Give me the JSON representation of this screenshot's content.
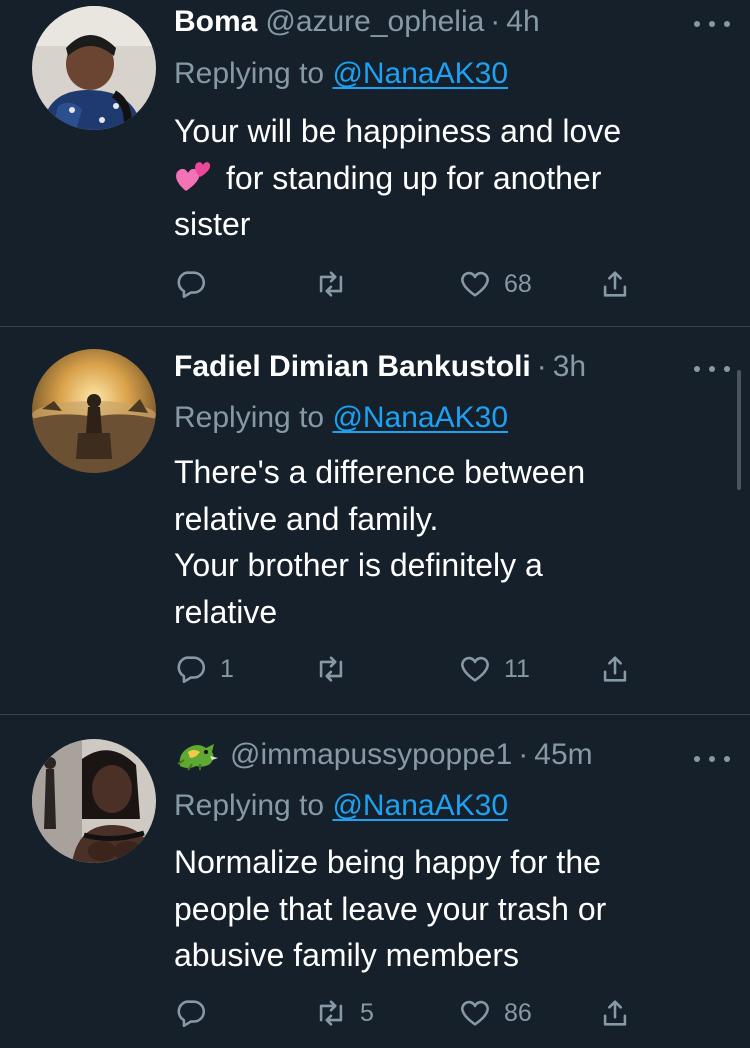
{
  "tweets": [
    {
      "name": "Boma",
      "handle": "@azure_ophelia",
      "separator": "·",
      "time": "4h",
      "replying_prefix": "Replying to",
      "replying_to": "@NanaAK30",
      "body_lines": [
        "Your will be happiness and love",
        "for standing up for another",
        "sister"
      ],
      "body_emoji": "heart-emoji",
      "actions": {
        "reply_count": "",
        "retweet_count": "",
        "like_count": "68"
      }
    },
    {
      "name": "Fadiel Dimian Bankustoli",
      "handle": "",
      "separator": "·",
      "time": "3h",
      "replying_prefix": "Replying to",
      "replying_to": "@NanaAK30",
      "body_lines": [
        "There's a difference between",
        "relative and family.",
        "Your brother is definitely a",
        "relative"
      ],
      "actions": {
        "reply_count": "1",
        "retweet_count": "",
        "like_count": "11"
      }
    },
    {
      "name_emoji": "dragon-emoji",
      "handle": "@immapussypoppe1",
      "separator": "·",
      "time": "45m",
      "replying_prefix": "Replying to",
      "replying_to": "@NanaAK30",
      "body_lines": [
        "Normalize being happy for the",
        "people that leave your trash or",
        "abusive family members"
      ],
      "actions": {
        "reply_count": "",
        "retweet_count": "5",
        "like_count": "86"
      }
    }
  ],
  "colors": {
    "background": "#15202b",
    "divider": "#38444d",
    "secondary_text": "#8899a6",
    "link": "#1da1f2"
  }
}
